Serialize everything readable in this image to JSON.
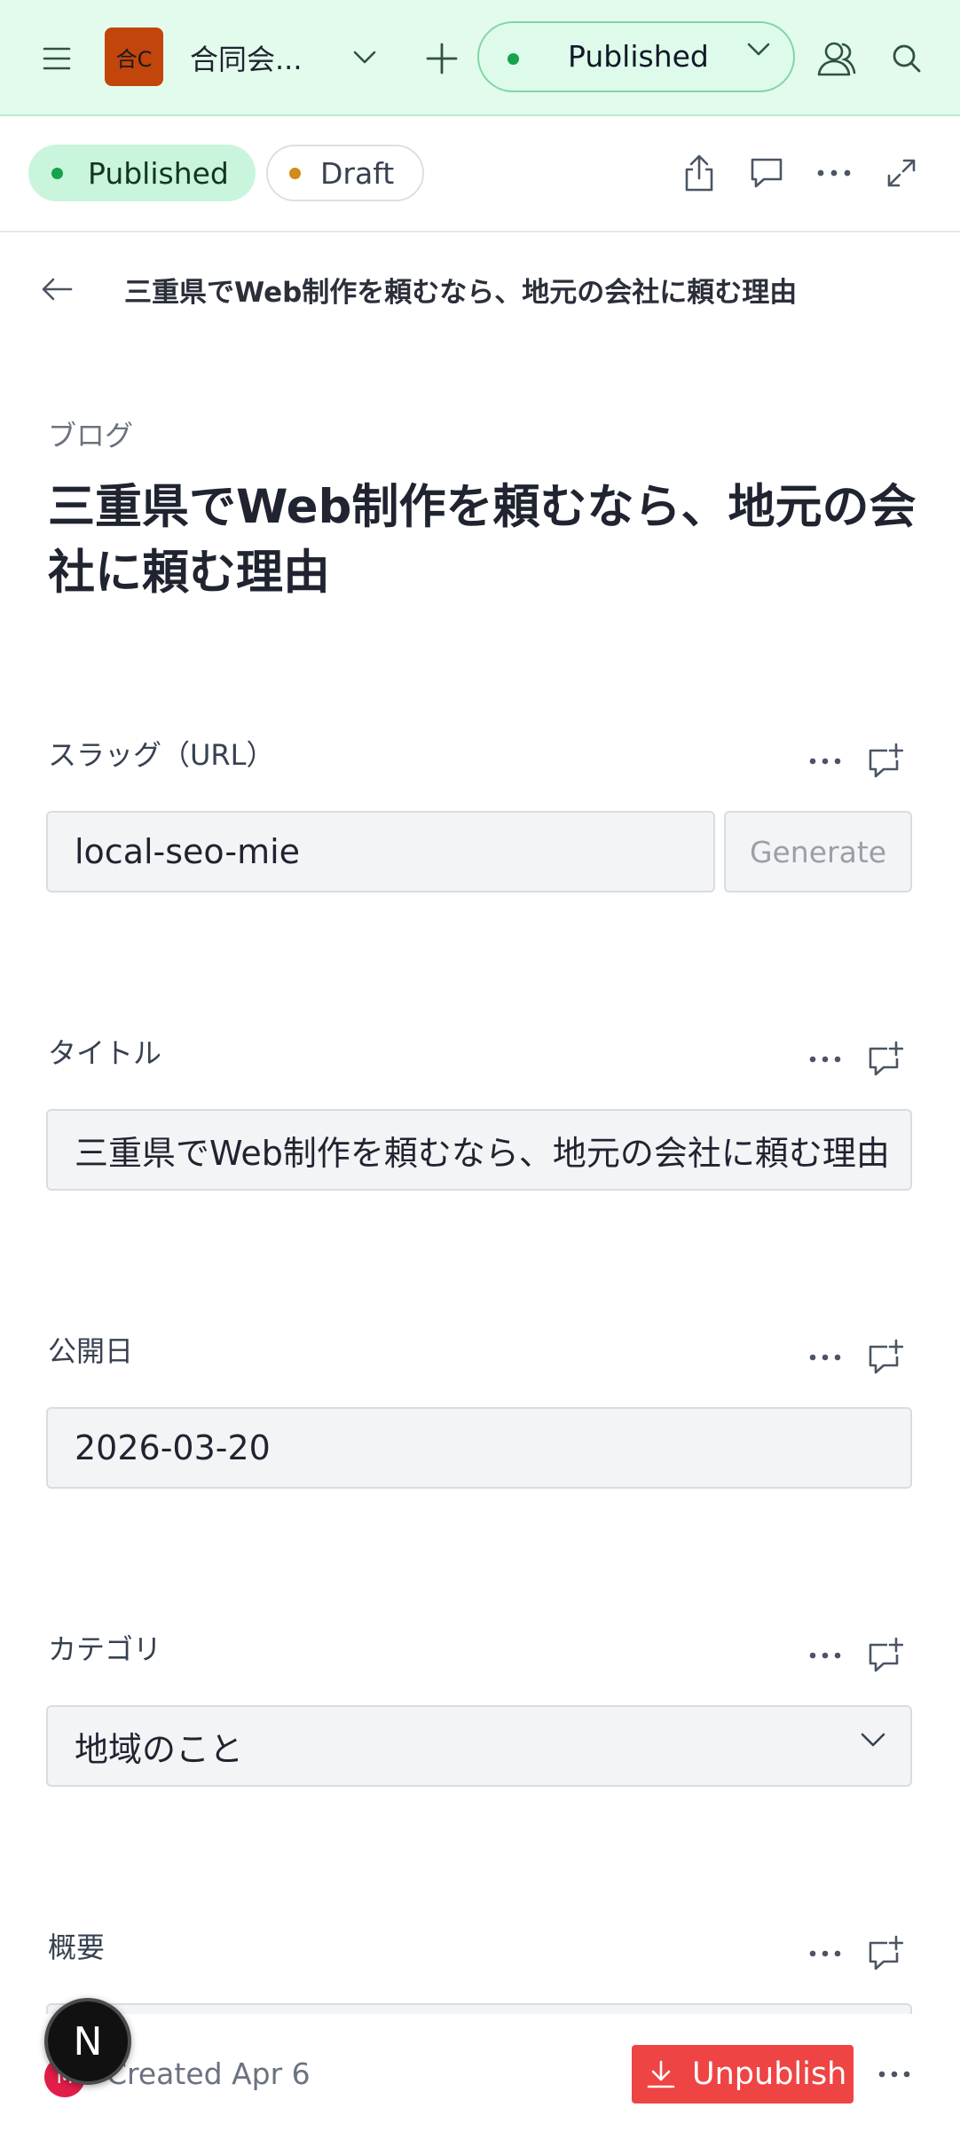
{
  "topbar": {
    "workspace_badge": "合C",
    "workspace_name": "合同会...",
    "status_label": "Published",
    "colors": {
      "background": "#e3fbed",
      "badge": "#c2450c",
      "status_dot": "#16a34a"
    }
  },
  "toolbar": {
    "published_label": "Published",
    "draft_label": "Draft",
    "icons": [
      "share-icon",
      "comment-icon",
      "more-icon",
      "expand-icon"
    ]
  },
  "breadcrumb": {
    "title": "三重県でWeb制作を頼むなら、地元の会社に頼む理由"
  },
  "document": {
    "collection": "ブログ",
    "title": "三重県でWeb制作を頼むなら、地元の会社に頼む理由"
  },
  "fields": {
    "slug": {
      "label": "スラッグ（URL）",
      "value": "local-seo-mie",
      "generate_label": "Generate"
    },
    "title": {
      "label": "タイトル",
      "value": "三重県でWeb制作を頼むなら、地元の会社に頼む理由"
    },
    "publish_date": {
      "label": "公開日",
      "value": "2026-03-20"
    },
    "category": {
      "label": "カテゴリ",
      "value": "地域のこと"
    },
    "summary": {
      "label": "概要"
    }
  },
  "footer": {
    "avatar_initial": "M",
    "created_text": "Created Apr 6",
    "unpublish_label": "Unpublish",
    "fab_label": "N",
    "colors": {
      "unpublish": "#ef4444",
      "avatar": "#e11d48"
    }
  }
}
